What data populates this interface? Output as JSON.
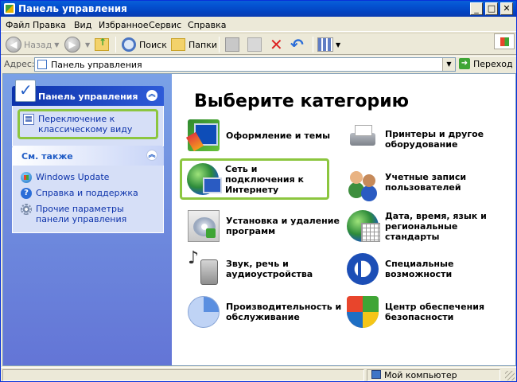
{
  "window": {
    "title": "Панель управления"
  },
  "menu": [
    "Файл",
    "Правка",
    "Вид",
    "Избранное",
    "Сервис",
    "Справка"
  ],
  "toolbar": {
    "back": "Назад",
    "search": "Поиск",
    "folders": "Папки"
  },
  "address": {
    "label": "Адрес:",
    "value": "Панель управления",
    "go": "Переход"
  },
  "sidebar": {
    "panel1_title": "Панель управления",
    "switch_view": "Переключение к классическому виду",
    "panel2_title": "См. также",
    "links": [
      "Windows Update",
      "Справка и поддержка",
      "Прочие параметры панели управления"
    ]
  },
  "main": {
    "heading": "Выберите категорию",
    "categories": [
      "Оформление и темы",
      "Принтеры и другое оборудование",
      "Сеть и подключения к Интернету",
      "Учетные записи пользователей",
      "Установка и удаление программ",
      "Дата, время, язык и региональные стандарты",
      "Звук, речь и аудиоустройства",
      "Специальные возможности",
      "Производительность и обслуживание",
      "Центр обеспечения безопасности"
    ]
  },
  "status": {
    "location": "Мой компьютер"
  }
}
